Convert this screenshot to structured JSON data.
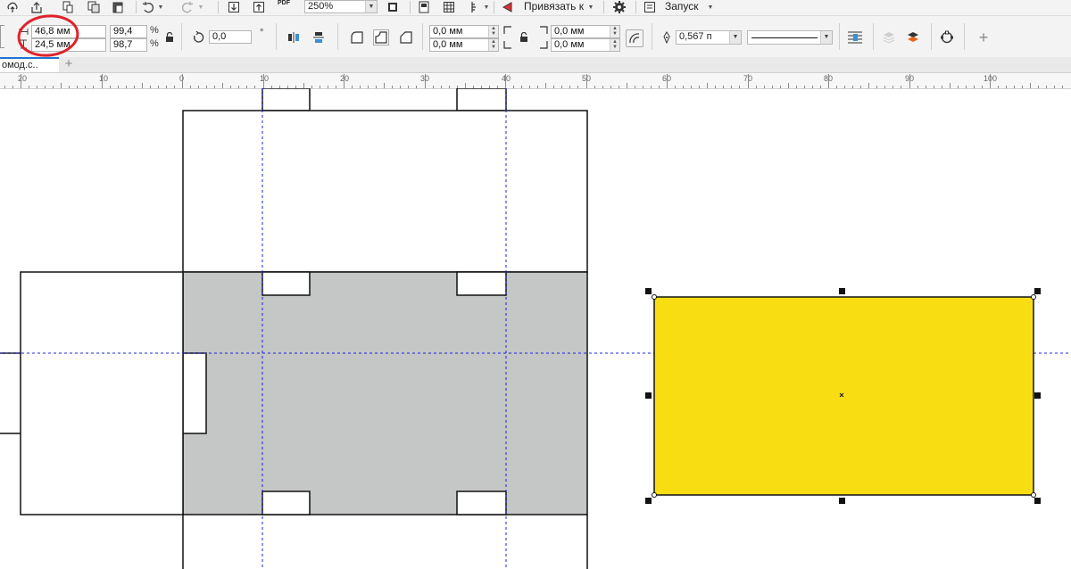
{
  "toolbar": {
    "zoom_value": "250%",
    "snap_label": "Привязать к",
    "launch_label": "Запуск",
    "pdf_label": "PDF"
  },
  "properties": {
    "width": "46,8 мм",
    "height": "24,5 мм",
    "scale_x": "99,4",
    "scale_y": "98,7",
    "percent_symbol": "%",
    "rotation": "0,0",
    "degree_symbol": "°",
    "corner_radius_tl": "0,0 мм",
    "corner_radius_bl": "0,0 мм",
    "corner_radius_tr": "0,0 мм",
    "corner_radius_br": "0,0 мм",
    "outline_width": "0,567 п"
  },
  "document_tab": {
    "label": "омод.с..",
    "add_symbol": "+"
  },
  "ruler": {
    "labels": [
      "20",
      "10",
      "0",
      "10",
      "20",
      "30",
      "40",
      "50",
      "60",
      "70",
      "80",
      "90",
      "100"
    ]
  },
  "colors": {
    "selected_rect_fill": "#f9dd13",
    "panel_fill": "#c5c6c6",
    "guide_line": "#1d24d8",
    "annotation_circle": "#e0222a",
    "active_tab": "#1e74d0"
  },
  "icons": [
    "cloud-upload-icon",
    "export-icon",
    "copy-style-icon",
    "clone-icon",
    "paste-icon",
    "undo-icon",
    "redo-icon",
    "import-icon",
    "export-arrow-icon",
    "publish-pdf-icon",
    "full-screen-icon",
    "page-icon",
    "grid-icon",
    "snap-icon",
    "settings-icon",
    "launch-icon",
    "lock-ratio-icon",
    "rotate-icon",
    "mirror-horizontal-icon",
    "mirror-vertical-icon",
    "round-corner-icon",
    "scallop-corner-icon",
    "chamfer-corner-icon",
    "lock-corners-icon",
    "relative-scaling-icon",
    "pen-icon",
    "wrap-text-icon",
    "to-front-icon",
    "to-back-icon",
    "convert-to-curves-icon",
    "add-icon"
  ]
}
